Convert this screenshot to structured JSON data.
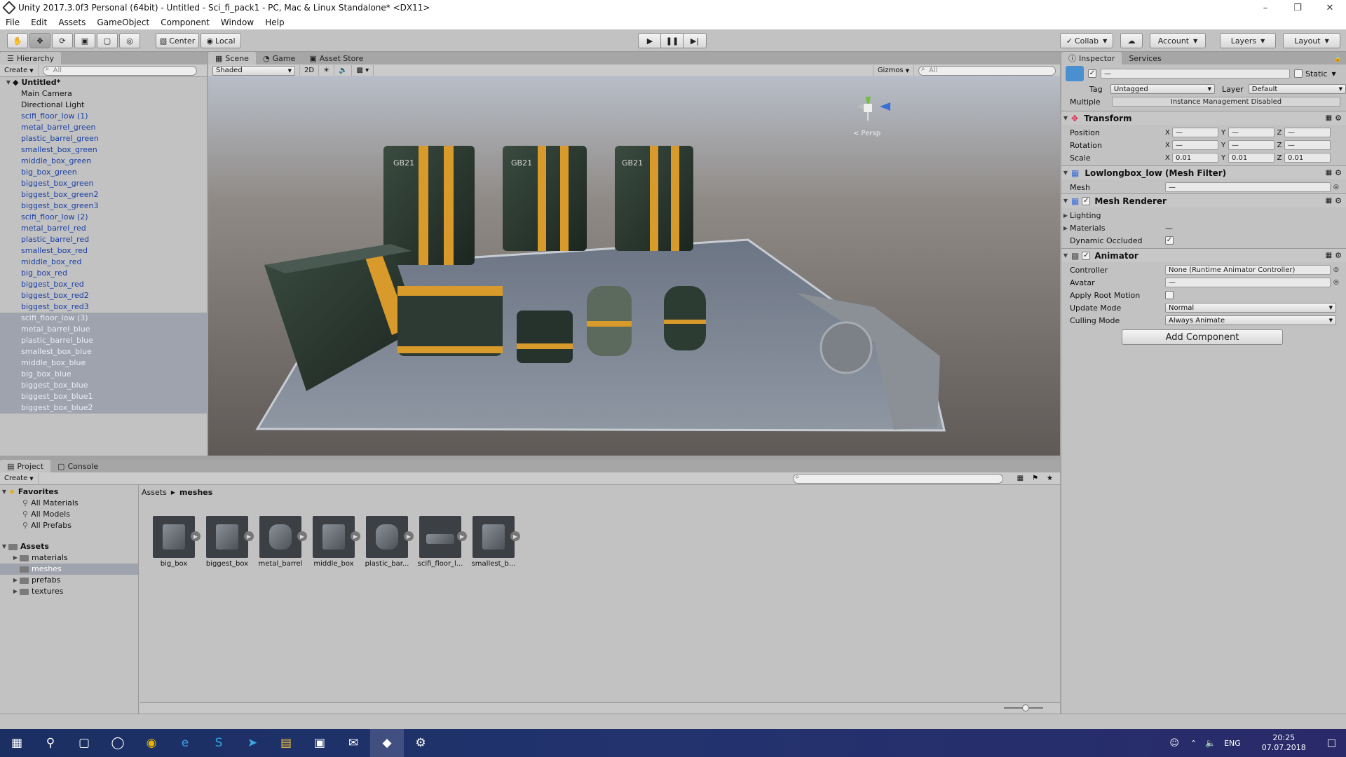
{
  "window": {
    "title": "Unity 2017.3.0f3 Personal (64bit) - Untitled - Sci_fi_pack1 - PC, Mac & Linux Standalone* <DX11>"
  },
  "menu": [
    "File",
    "Edit",
    "Assets",
    "GameObject",
    "Component",
    "Window",
    "Help"
  ],
  "toolbar": {
    "center_label": "Center",
    "local_label": "Local",
    "collab_label": "Collab",
    "account_label": "Account",
    "layers_label": "Layers",
    "layout_label": "Layout"
  },
  "hierarchy": {
    "tab": "Hierarchy",
    "create": "Create",
    "search_placeholder": "All",
    "scene_name": "Untitled*",
    "items": [
      "Main Camera",
      "Directional Light",
      "scifi_floor_low (1)",
      "metal_barrel_green",
      "plastic_barrel_green",
      "smallest_box_green",
      "middle_box_green",
      "big_box_green",
      "biggest_box_green",
      "biggest_box_green2",
      "biggest_box_green3",
      "scifi_floor_low (2)",
      "metal_barrel_red",
      "plastic_barrel_red",
      "smallest_box_red",
      "middle_box_red",
      "big_box_red",
      "biggest_box_red",
      "biggest_box_red2",
      "biggest_box_red3",
      "scifi_floor_low (3)",
      "metal_barrel_blue",
      "plastic_barrel_blue",
      "smallest_box_blue",
      "middle_box_blue",
      "big_box_blue",
      "biggest_box_blue",
      "biggest_box_blue1",
      "biggest_box_blue2"
    ]
  },
  "scene": {
    "tabs": [
      "Scene",
      "Game",
      "Asset Store"
    ],
    "shading": "Shaded",
    "mode2d": "2D",
    "gizmos": "Gizmos",
    "search_placeholder": "All",
    "persp": "< Persp",
    "crate_label": "GB21"
  },
  "inspector": {
    "tabs": [
      "Inspector",
      "Services"
    ],
    "name_value": "—",
    "static_label": "Static",
    "tag_label": "Tag",
    "tag_value": "Untagged",
    "layer_label": "Layer",
    "layer_value": "Default",
    "multiple_label": "Multiple",
    "instance_mgmt": "Instance Management Disabled",
    "transform": {
      "title": "Transform",
      "position_label": "Position",
      "rotation_label": "Rotation",
      "scale_label": "Scale",
      "x": "X",
      "y": "Y",
      "z": "Z",
      "position": [
        "—",
        "—",
        "—"
      ],
      "rotation": [
        "—",
        "—",
        "—"
      ],
      "scale": [
        "0.01",
        "0.01",
        "0.01"
      ]
    },
    "mesh_filter": {
      "title": "Lowlongbox_low (Mesh Filter)",
      "mesh_label": "Mesh",
      "mesh_value": "—"
    },
    "mesh_renderer": {
      "title": "Mesh Renderer",
      "lighting": "Lighting",
      "materials": "Materials",
      "materials_value": "—",
      "dynamic_occluded": "Dynamic Occluded"
    },
    "animator": {
      "title": "Animator",
      "controller_label": "Controller",
      "controller_value": "None (Runtime Animator Controller)",
      "avatar_label": "Avatar",
      "avatar_value": "—",
      "apply_root_motion": "Apply Root Motion",
      "update_mode_label": "Update Mode",
      "update_mode_value": "Normal",
      "culling_mode_label": "Culling Mode",
      "culling_mode_value": "Always Animate"
    },
    "add_component": "Add Component"
  },
  "project": {
    "tabs": [
      "Project",
      "Console"
    ],
    "create": "Create",
    "favorites": "Favorites",
    "fav_items": [
      "All Materials",
      "All Models",
      "All Prefabs"
    ],
    "assets_root": "Assets",
    "folders": [
      "materials",
      "meshes",
      "prefabs",
      "textures"
    ],
    "breadcrumb": [
      "Assets",
      "meshes"
    ],
    "assets": [
      "big_box",
      "biggest_box",
      "metal_barrel",
      "middle_box",
      "plastic_bar...",
      "scifi_floor_l...",
      "smallest_b..."
    ]
  },
  "taskbar": {
    "lang": "ENG",
    "time": "20:25",
    "date": "07.07.2018"
  }
}
